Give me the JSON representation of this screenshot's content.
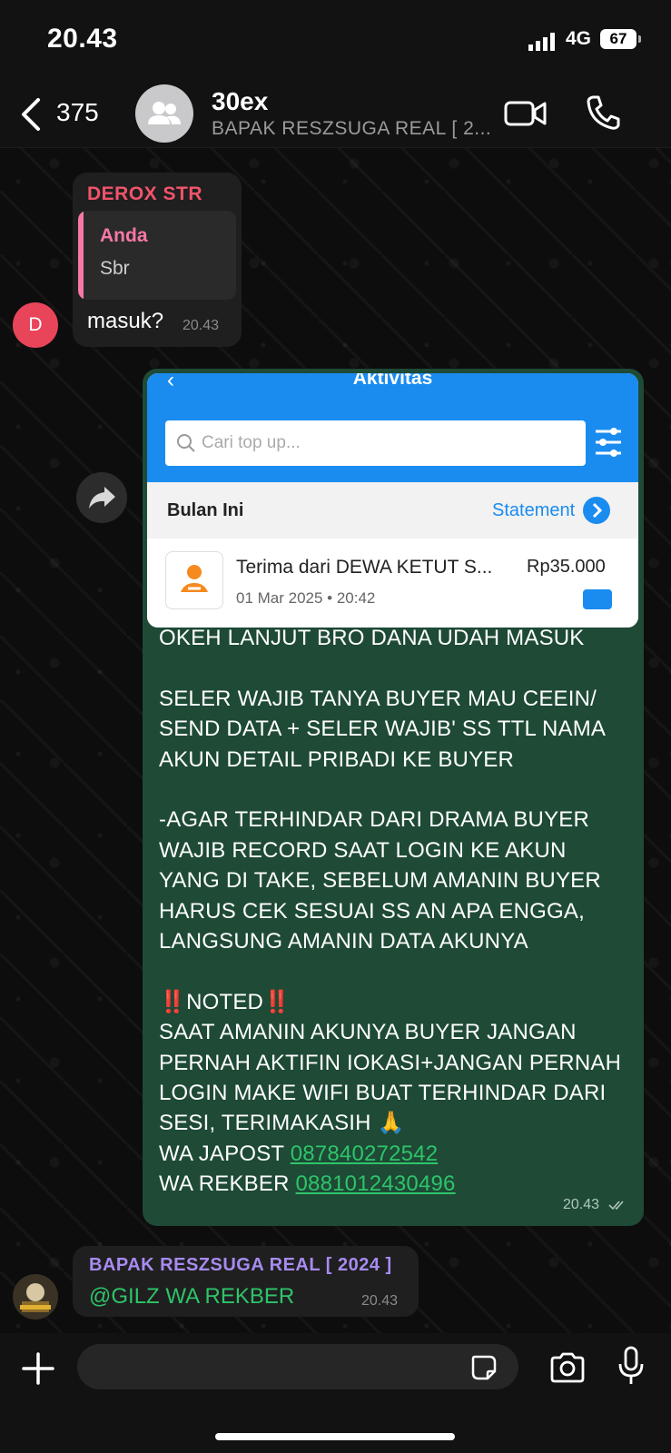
{
  "status_bar": {
    "time": "20.43",
    "network": "4G",
    "battery": "67"
  },
  "header": {
    "back_count": "375",
    "title": "30ex",
    "subtitle": "BAPAK RESZSUGA REAL [ 2..."
  },
  "messages": [
    {
      "sender": "DEROX STR",
      "avatar_letter": "D",
      "quote": {
        "name": "Anda",
        "text": "Sbr"
      },
      "text": "masuk?",
      "time": "20.43"
    },
    {
      "screenshot": {
        "title": "Aktivitas",
        "search_placeholder": "Cari top up...",
        "month_label": "Bulan Ini",
        "statement_label": "Statement",
        "tx_title": "Terima dari DEWA KETUT S...",
        "tx_amount": "Rp35.000",
        "tx_date": "01 Mar 2025 • 20:42"
      },
      "lines": [
        "OKEH LANJUT BRO DANA UDAH MASUK",
        "SELER WAJIB TANYA BUYER MAU CEEIN/ SEND DATA + SELER WAJIB' SS TTL NAMA AKUN DETAIL PRIBADI KE BUYER",
        "-AGAR TERHINDAR DARI DRAMA BUYER WAJIB RECORD SAAT LOGIN KE AKUN YANG DI TAKE, SEBELUM AMANIN BUYER HARUS CEK SESUAI SS AN APA ENGGA, LANGSUNG AMANIN DATA AKUNYA",
        "NOTED",
        "SAAT AMANIN AKUNYA BUYER JANGAN PERNAH AKTIFIN IOKASI+JANGAN PERNAH LOGIN MAKE WIFI BUAT TERHINDAR DARI SESI, TERIMAKASIH 🙏",
        "WA JAPOST ",
        "087840272542",
        "WA REKBER ",
        "0881012430496"
      ],
      "bang": "‼️",
      "time": "20.43"
    },
    {
      "sender": "BAPAK RESZSUGA REAL [ 2024 ]",
      "mention": "@GILZ WA REKBER",
      "time": "20.43"
    }
  ]
}
